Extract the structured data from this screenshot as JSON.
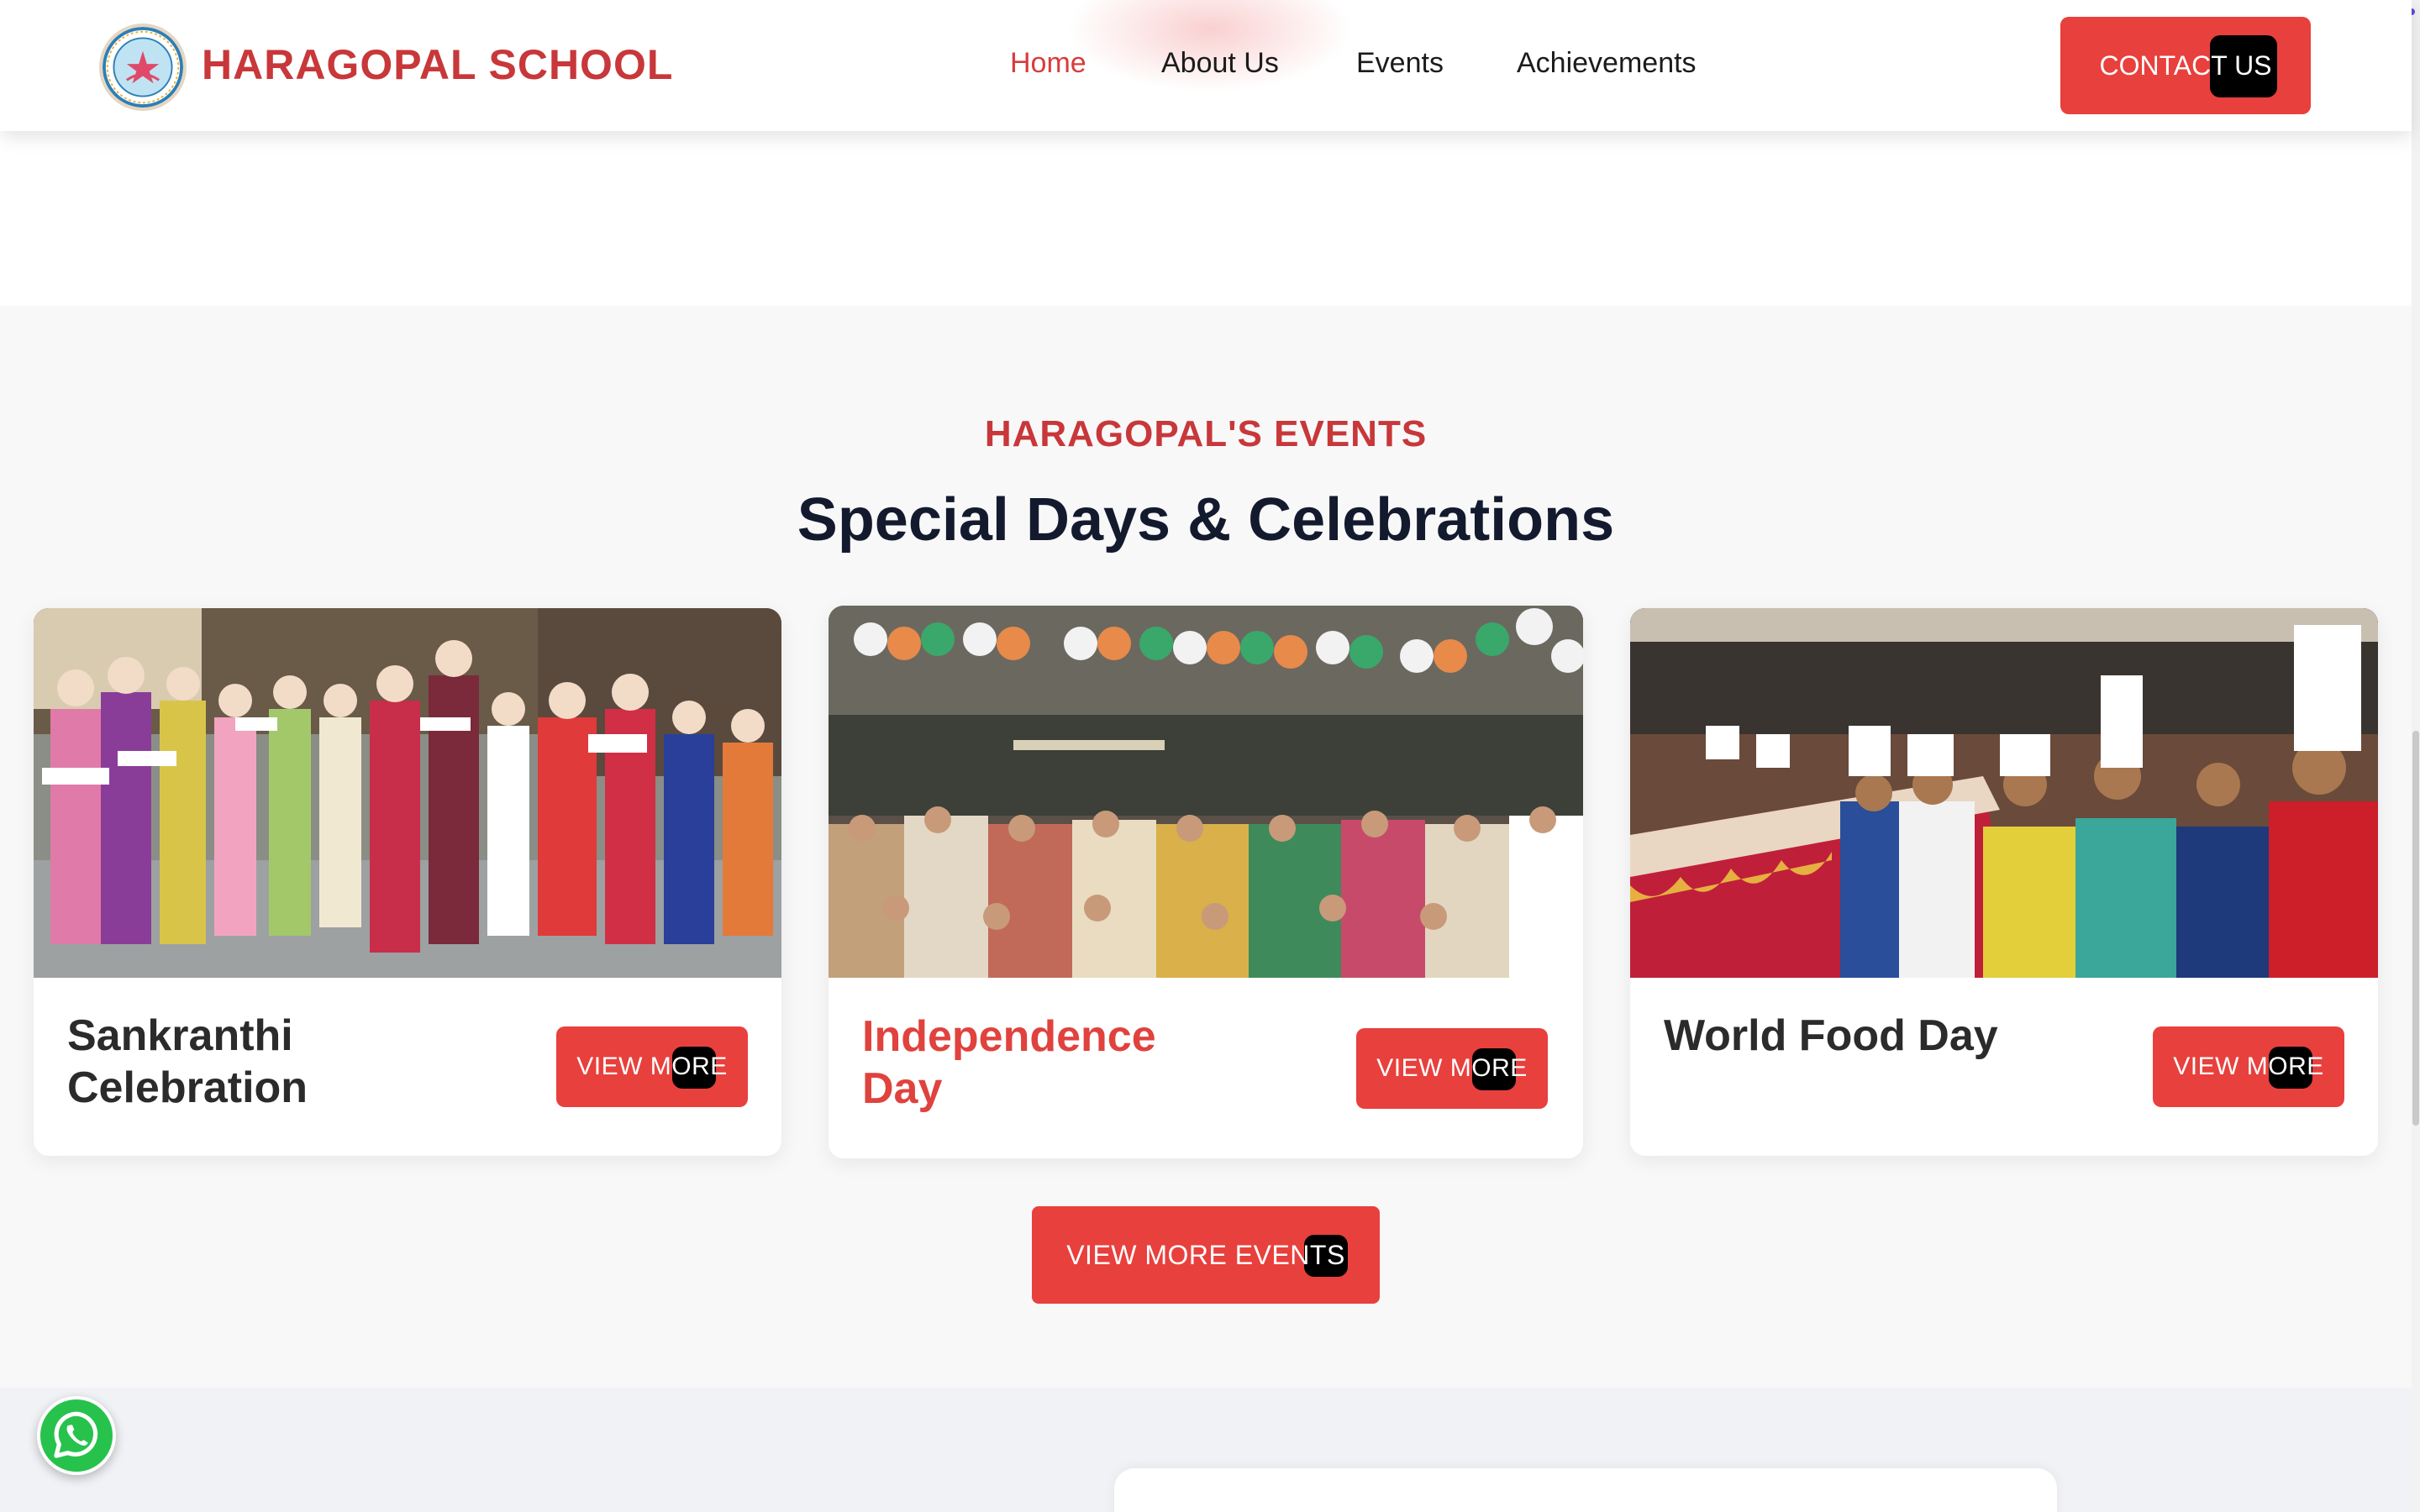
{
  "header": {
    "brand": "HARAGOPAL SCHOOL",
    "nav": [
      {
        "label": "Home",
        "active": true
      },
      {
        "label": "About Us"
      },
      {
        "label": "Events"
      },
      {
        "label": "Achievements"
      }
    ],
    "contact_label": "CONTACT US"
  },
  "events": {
    "eyebrow": "HARAGOPAL'S EVENTS",
    "heading": "Special Days & Celebrations",
    "cards": [
      {
        "title_line1": "Sankranthi",
        "title_line2": "Celebration",
        "button": "VIEW MORE"
      },
      {
        "title_line1": "Independence",
        "title_line2": "Day",
        "button": "VIEW MORE"
      },
      {
        "title_line1": "World Food Day",
        "title_line2": "",
        "button": "VIEW MORE"
      }
    ],
    "more_button": "VIEW MORE EVENTS"
  },
  "colors": {
    "accent": "#e8403d",
    "brand_red": "#c8373a",
    "heading": "#141a2e",
    "whatsapp": "#27c24c"
  },
  "icons": {
    "logo": "school-logo",
    "whatsapp": "whatsapp-icon"
  }
}
